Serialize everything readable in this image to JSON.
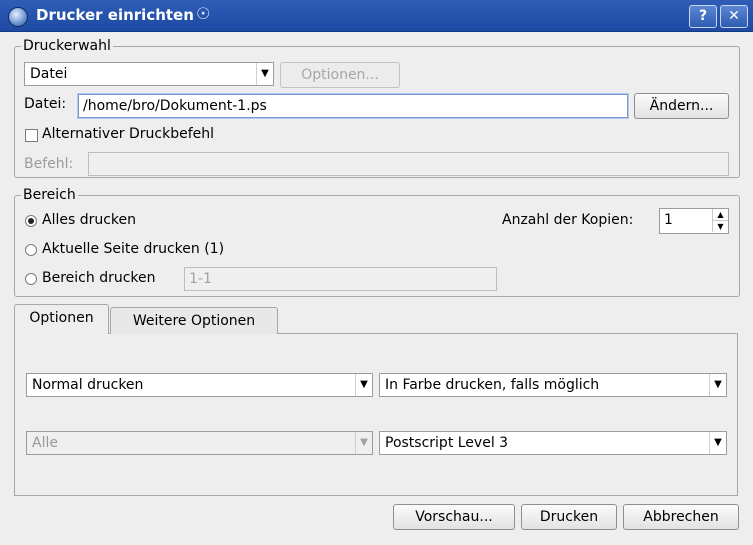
{
  "window": {
    "title": "Drucker einrichten",
    "help_button": "?",
    "close_button": "X"
  },
  "printer_group": {
    "legend": "Druckerwahl",
    "printer_select": "Datei",
    "options_button": "Optionen...",
    "file_label": "Datei:",
    "file_value": "/home/bro/Dokument-1.ps",
    "change_button": "Ändern...",
    "alt_command_label": "Alternativer Druckbefehl",
    "alt_command_checked": false,
    "command_label": "Befehl:",
    "command_value": ""
  },
  "range_group": {
    "legend": "Bereich",
    "all_pages": "Alles drucken",
    "current_page": "Aktuelle Seite drucken (1)",
    "page_range": "Bereich drucken",
    "page_range_value": "1-1",
    "selected": "all_pages",
    "copies_label": "Anzahl der Kopien:",
    "copies_value": "1"
  },
  "tabs": {
    "options_tab": "Optionen",
    "more_options_tab": "Weitere Optionen",
    "active": "options_tab"
  },
  "options_panel": {
    "print_mode": "Normal drucken",
    "color_mode": "In Farbe drucken, falls möglich",
    "page_set": "Alle",
    "postscript_level": "Postscript Level 3"
  },
  "footer": {
    "preview_button": "Vorschau...",
    "print_button": "Drucken",
    "cancel_button": "Abbrechen"
  },
  "icons": {
    "app": "printer-app-icon",
    "title_swirl": "suse-swirl-icon",
    "combo_arrow": "chevron-down-icon",
    "spin_up": "spin-up-icon",
    "spin_down": "spin-down-icon"
  }
}
